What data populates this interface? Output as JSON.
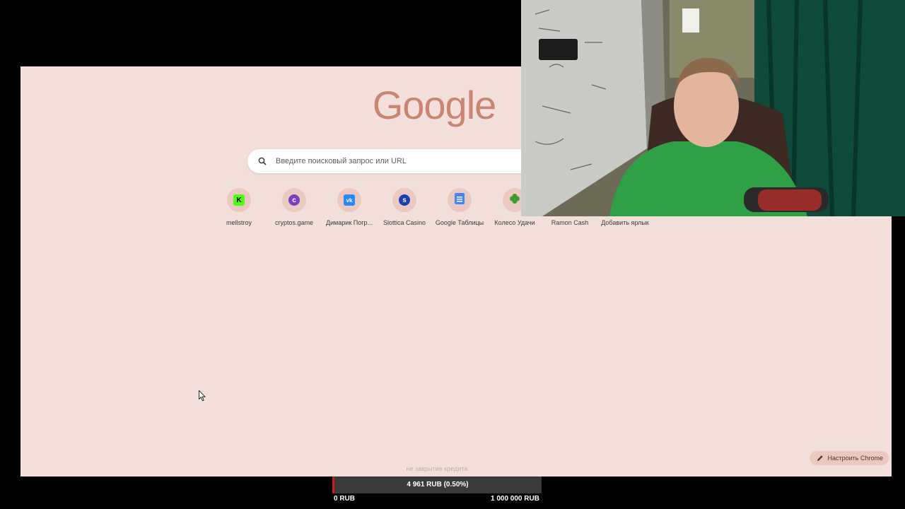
{
  "new_tab": {
    "logo_text": "Google",
    "search_placeholder": "Введите поисковый запрос или URL",
    "shortcuts": [
      {
        "label": "mellstroy",
        "icon": "kick-icon",
        "glyph": "K",
        "color": "#53fc18"
      },
      {
        "label": "cryptos.game",
        "icon": "cryptos-icon",
        "glyph": "c",
        "color": "#7b3fc4"
      },
      {
        "label": "Димарик Погр...",
        "icon": "vk-icon",
        "glyph": "vk",
        "color": "#2787f5"
      },
      {
        "label": "Slottica Casino",
        "icon": "slottica-icon",
        "glyph": "s",
        "color": "#1a3fb3"
      },
      {
        "label": "Google Таблицы",
        "icon": "sheets-icon",
        "glyph": "",
        "color": "#4285f4"
      },
      {
        "label": "Колесо Удачи",
        "icon": "clover-icon",
        "glyph": "",
        "color": "#3f9e2f"
      },
      {
        "label": "Ramon Cash",
        "icon": "ramon-icon",
        "glyph": "",
        "color": "#8e6b3a"
      },
      {
        "label": "Добавить ярлык",
        "icon": "plus-icon",
        "glyph": "+",
        "color": "#5a2e22"
      }
    ],
    "customize_label": "Настроить Chrome"
  },
  "stream_overlay": {
    "caption": "не закрытие кредита",
    "progress_value": "4 961 RUB (0.50%)",
    "progress_fraction": 0.005,
    "min_label": "0 RUB",
    "max_label": "1 000 000 RUB",
    "accent": "#d01919"
  }
}
